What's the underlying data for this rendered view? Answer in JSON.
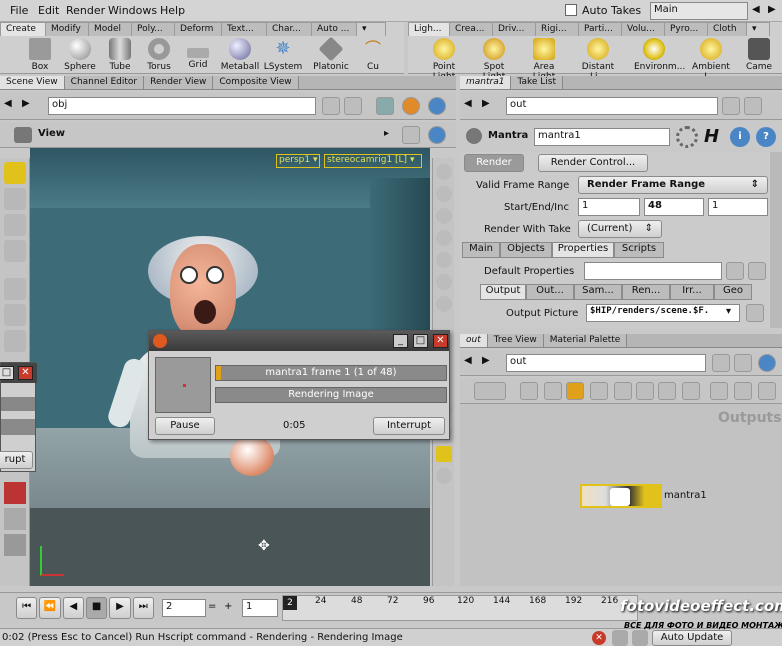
{
  "menubar": {
    "items": [
      "File",
      "Edit",
      "Render",
      "Windows",
      "Help"
    ],
    "auto_takes": "Auto Takes",
    "desktop": "Main"
  },
  "shelf_left": {
    "tabs": [
      "Create",
      "Modify",
      "Model",
      "Poly...",
      "Deform",
      "Text...",
      "Char...",
      "Auto ..."
    ],
    "tools": [
      "Box",
      "Sphere",
      "Tube",
      "Torus",
      "Grid",
      "Metaball",
      "LSystem",
      "Platonic ...",
      "Cu"
    ]
  },
  "shelf_right": {
    "tabs": [
      "Ligh...",
      "Crea...",
      "Driv...",
      "Rigi...",
      "Parti...",
      "Volu...",
      "Pyro...",
      "Cloth"
    ],
    "tools": [
      "Point Light",
      "Spot Light",
      "Area Light",
      "Distant Li...",
      "Environm...",
      "Ambient L...",
      "Came"
    ]
  },
  "left_pane": {
    "tabs": [
      "Scene View",
      "Channel Editor",
      "Render View",
      "Composite View"
    ],
    "path": "obj",
    "view_label": "View",
    "camera_menu": "persp1",
    "stereo_menu": "stereocamrig1 [L]"
  },
  "render_dialog": {
    "progress_label": "mantra1 frame 1 (1 of 48)",
    "status_label": "Rendering Image",
    "progress": 0.02,
    "pause": "Pause",
    "elapsed": "0:05",
    "interrupt": "Interrupt"
  },
  "partial_dialog": {
    "button": "rupt"
  },
  "param_pane": {
    "tabs": [
      "mantra1",
      "Take List"
    ],
    "path": "out",
    "node_type": "Mantra",
    "node_name": "mantra1",
    "render_btn": "Render",
    "render_control_btn": "Render Control...",
    "valid_frame_range_label": "Valid Frame Range",
    "valid_frame_range_value": "Render Frame Range",
    "start_end_inc_label": "Start/End/Inc",
    "start": "1",
    "end": "48",
    "inc": "1",
    "render_with_take_label": "Render With Take",
    "render_with_take_value": "(Current)",
    "sub_tabs": [
      "Main",
      "Objects",
      "Properties",
      "Scripts"
    ],
    "default_properties_label": "Default Properties",
    "prop_tabs": [
      "Output",
      "Out...",
      "Sam...",
      "Ren...",
      "Irr...",
      "Geo"
    ],
    "output_picture_label": "Output Picture",
    "output_picture_value": "$HIP/renders/scene.$F."
  },
  "network_pane": {
    "tabs": [
      "out",
      "Tree View",
      "Material Palette"
    ],
    "path": "out",
    "outputs_label": "Outputs",
    "node_label": "mantra1"
  },
  "timeline": {
    "frame": "2",
    "start": "1",
    "ticks": [
      "24",
      "48",
      "72",
      "96",
      "120",
      "144",
      "168",
      "192",
      "216"
    ],
    "current_frame": "2"
  },
  "status": {
    "message": "0:02 (Press Esc to Cancel) Run Hscript command - Rendering - Rendering Image",
    "auto_update": "Auto Update"
  },
  "watermark": {
    "line1": "fotovideoeffect.com",
    "line2": "ВСЕ ДЛЯ ФОТО И ВИДЕО МОНТАЖА!"
  },
  "colors": {
    "accent": "#e0c21a",
    "close": "#c83a2a",
    "viewport": "#3d6b78"
  }
}
